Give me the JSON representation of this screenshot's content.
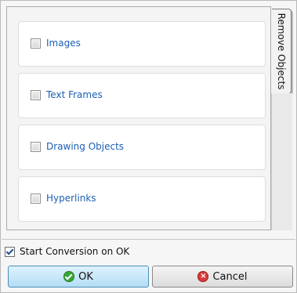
{
  "tab": {
    "label": "Remove Objects"
  },
  "options": [
    {
      "label": "Images",
      "checked": false
    },
    {
      "label": "Text Frames",
      "checked": false
    },
    {
      "label": "Drawing Objects",
      "checked": false
    },
    {
      "label": "Hyperlinks",
      "checked": false
    }
  ],
  "start_conversion": {
    "label": "Start Conversion on OK",
    "checked": true
  },
  "buttons": {
    "ok_label": "OK",
    "cancel_label": "Cancel"
  },
  "icons": {
    "ok": "check-circle-icon",
    "cancel": "x-circle-icon"
  },
  "colors": {
    "option_text": "#1a5fb4",
    "ok_button": "#b3ddf5",
    "ok_icon": "#3aa63a",
    "cancel_icon": "#d63a3a"
  }
}
